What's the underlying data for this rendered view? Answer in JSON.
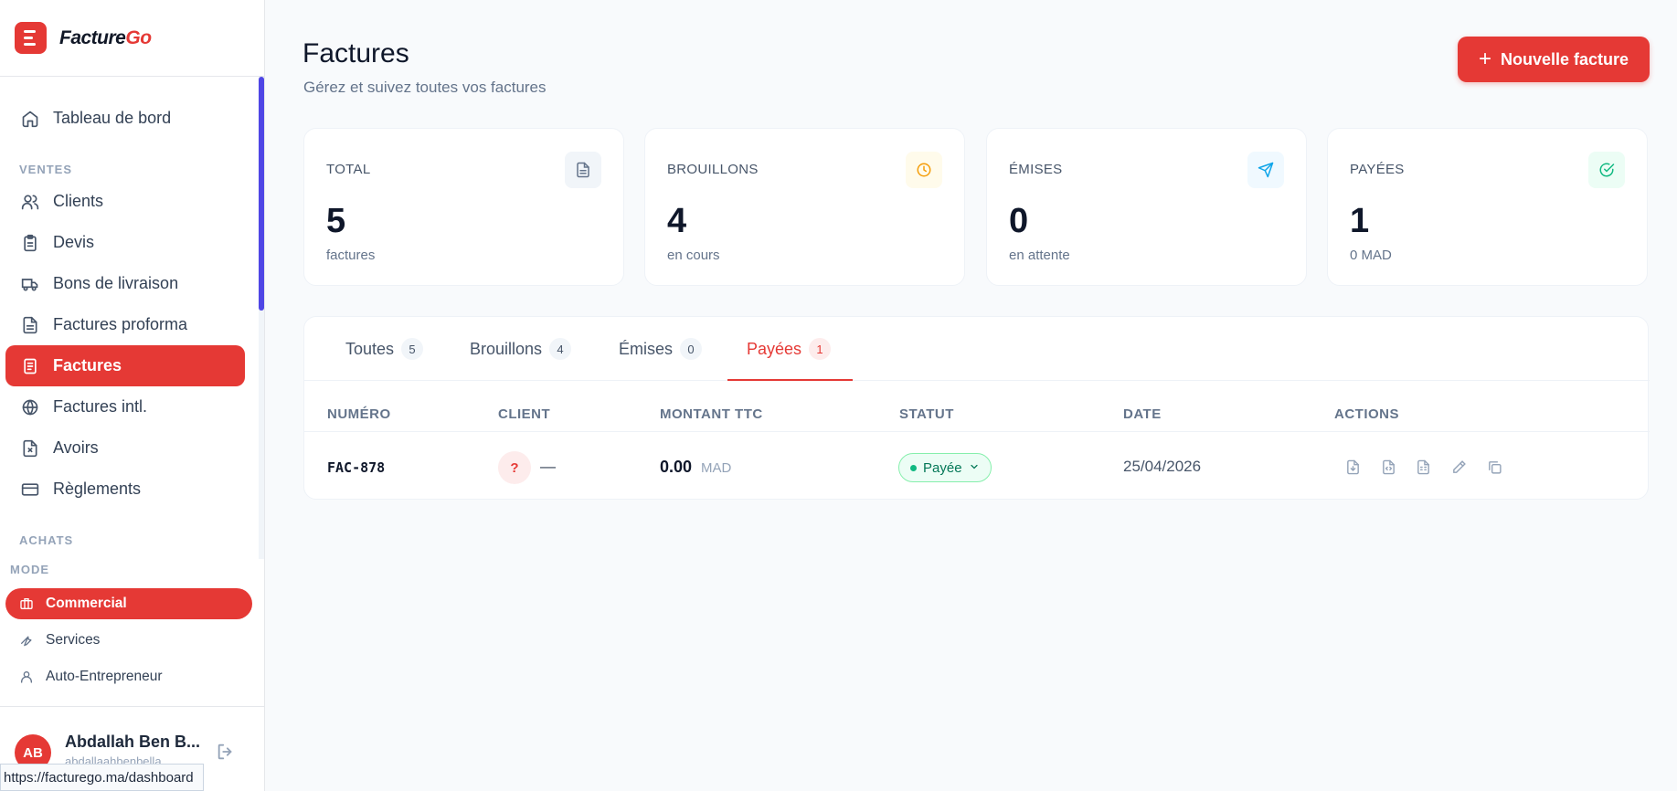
{
  "app": {
    "logo_prefix": "Facture",
    "logo_suffix": "Go"
  },
  "sidebar": {
    "dashboard": "Tableau de bord",
    "section_ventes": "VENTES",
    "items": [
      {
        "label": "Clients",
        "icon": "users-icon"
      },
      {
        "label": "Devis",
        "icon": "clipboard-icon"
      },
      {
        "label": "Bons de livraison",
        "icon": "truck-icon"
      },
      {
        "label": "Factures proforma",
        "icon": "file-icon"
      },
      {
        "label": "Factures",
        "icon": "receipt-icon",
        "active": true
      },
      {
        "label": "Factures intl.",
        "icon": "globe-icon"
      },
      {
        "label": "Avoirs",
        "icon": "file-x-icon"
      },
      {
        "label": "Règlements",
        "icon": "credit-card-icon"
      }
    ],
    "section_achats": "ACHATS",
    "mode_label": "MODE",
    "modes": [
      {
        "label": "Commercial",
        "icon": "briefcase-icon",
        "active": true
      },
      {
        "label": "Services",
        "icon": "wrench-icon"
      },
      {
        "label": "Auto-Entrepreneur",
        "icon": "user-icon"
      }
    ],
    "user": {
      "initials": "AB",
      "name": "Abdallah Ben B...",
      "email": "abdallaahbenbella..."
    },
    "url_tooltip": "https://facturego.ma/dashboard"
  },
  "header": {
    "title": "Factures",
    "subtitle": "Gérez et suivez toutes vos factures",
    "new_button": "Nouvelle facture"
  },
  "stats": [
    {
      "label": "TOTAL",
      "value": "5",
      "sub": "factures",
      "icon": "document-icon",
      "color": "#64748b",
      "bg": "#f1f5f9"
    },
    {
      "label": "BROUILLONS",
      "value": "4",
      "sub": "en cours",
      "icon": "clock-icon",
      "color": "#f59e0b",
      "bg": "#fffbeb"
    },
    {
      "label": "ÉMISES",
      "value": "0",
      "sub": "en attente",
      "icon": "send-icon",
      "color": "#0ea5e9",
      "bg": "#f0f9ff"
    },
    {
      "label": "PAYÉES",
      "value": "1",
      "sub": "0 MAD",
      "icon": "check-circle-icon",
      "color": "#10b981",
      "bg": "#ecfdf5"
    }
  ],
  "tabs": [
    {
      "label": "Toutes",
      "count": "5"
    },
    {
      "label": "Brouillons",
      "count": "4"
    },
    {
      "label": "Émises",
      "count": "0"
    },
    {
      "label": "Payées",
      "count": "1",
      "active": true
    }
  ],
  "table": {
    "columns": [
      "NUMÉRO",
      "CLIENT",
      "MONTANT TTC",
      "STATUT",
      "DATE",
      "ACTIONS"
    ],
    "rows": [
      {
        "number": "FAC-878",
        "client_initial": "?",
        "client_name": "—",
        "amount": "0.00",
        "currency": "MAD",
        "status": "Payée",
        "date": "25/04/2026"
      }
    ]
  },
  "colors": {
    "accent": "#e53935",
    "sidebar_scroll": "#4f46e5"
  }
}
